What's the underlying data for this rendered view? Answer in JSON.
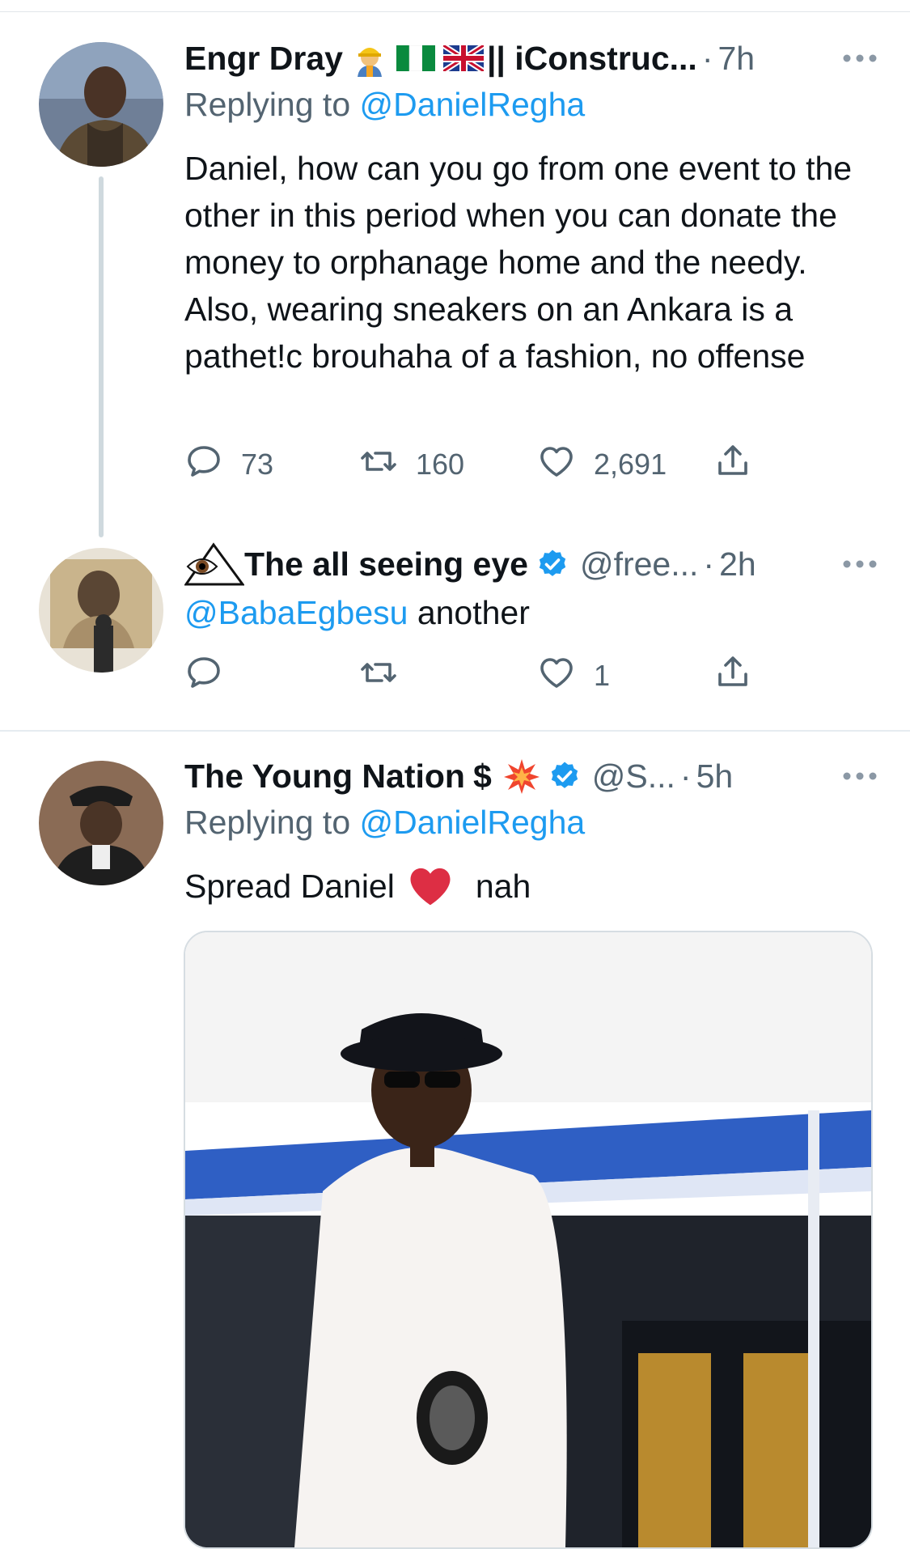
{
  "tweets": [
    {
      "name": "Engr Dray",
      "name_suffix": "|| iConstruc...",
      "time": "7h",
      "replying_label": "Replying to",
      "replying_handle": "@DanielRegha",
      "text": "Daniel, how can you go from one event to the other in this period when you can donate the money to orphanage home and the needy. Also, wearing sneakers on an Ankara is a pathet!c brouhaha of a fashion, no offense",
      "replies": "73",
      "retweets": "160",
      "likes": "2,691"
    },
    {
      "name": "The all seeing eye",
      "handle": "@free...",
      "time": "2h",
      "mention": "@BabaEgbesu",
      "text_after": " another",
      "likes": "1"
    },
    {
      "name": "The Young Nation",
      "name_symbol": "$",
      "handle": "@S...",
      "time": "5h",
      "replying_label": "Replying to",
      "replying_handle": "@DanielRegha",
      "text_before": "Spread Daniel",
      "text_after": "nah"
    }
  ],
  "colors": {
    "link": "#1d9bf0",
    "muted": "#536471",
    "text": "#0f1419",
    "heart": "#e0245e"
  },
  "icons": [
    "reply-icon",
    "retweet-icon",
    "like-icon",
    "share-icon",
    "more-icon",
    "verified-badge-icon",
    "construction-worker-emoji",
    "nigeria-flag-emoji",
    "uk-flag-emoji",
    "eye-emoji",
    "collision-emoji",
    "red-heart-emoji"
  ]
}
